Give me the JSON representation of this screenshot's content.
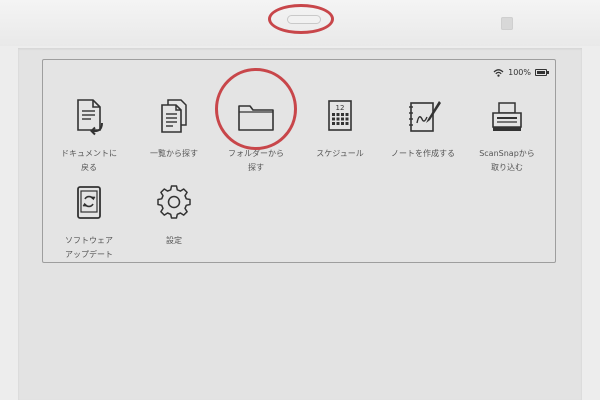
{
  "status_bar": {
    "wifi_icon": "wifi-icon",
    "battery_text": "100%",
    "battery_icon": "battery-full-icon"
  },
  "apps": [
    {
      "label": "ドキュメントに\n戻る",
      "icon": "document-return-icon"
    },
    {
      "label": "一覧から探す",
      "icon": "document-list-icon"
    },
    {
      "label": "フォルダーから\n探す",
      "icon": "folder-icon"
    },
    {
      "label": "スケジュール",
      "icon": "calendar-icon",
      "calendar_day": "12"
    },
    {
      "label": "ノートを作成する",
      "icon": "note-pen-icon"
    },
    {
      "label": "ScanSnapから\n取り込む",
      "icon": "scanner-icon"
    },
    {
      "label": "ソフトウェア\nアップデート",
      "icon": "software-update-icon"
    },
    {
      "label": "設定",
      "icon": "gear-icon"
    }
  ],
  "colors": {
    "highlight_ring": "#c8464a",
    "icon_stroke": "#333333",
    "label_text": "#555555"
  }
}
